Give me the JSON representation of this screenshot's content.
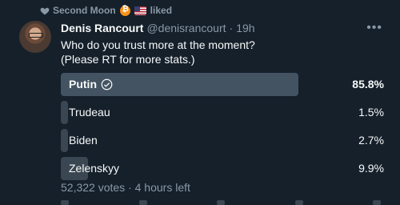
{
  "social_context": {
    "actor": "Second Moon",
    "action": "liked"
  },
  "tweet": {
    "author_name": "Denis Rancourt",
    "author_handle": "@denisrancourt",
    "separator": "·",
    "time": "19h",
    "text_line1": "Who do you trust more at the moment?",
    "text_line2": "(Please RT for more stats.)"
  },
  "poll": {
    "options": [
      {
        "label": "Putin",
        "percent_text": "85.8%",
        "percent": 85.8,
        "winner": true
      },
      {
        "label": "Trudeau",
        "percent_text": "1.5%",
        "percent": 1.5,
        "winner": false
      },
      {
        "label": "Biden",
        "percent_text": "2.7%",
        "percent": 2.7,
        "winner": false
      },
      {
        "label": "Zelenskyy",
        "percent_text": "9.9%",
        "percent": 9.9,
        "winner": false
      }
    ],
    "votes": "52,322 votes",
    "footer_separator": "·",
    "time_left": "4 hours left"
  },
  "colors": {
    "background": "#15202b",
    "bar": "#3a4651",
    "winner_bar": "#435362",
    "muted_text": "#8b98a5"
  },
  "icons": {
    "liked": "heart-icon",
    "more": "more-icon",
    "winner": "check-circle-icon"
  }
}
